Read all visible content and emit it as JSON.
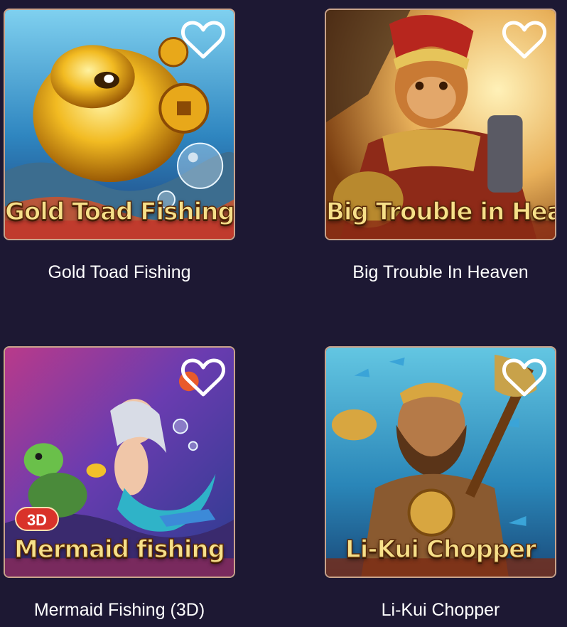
{
  "games": [
    {
      "title": "Gold Toad Fishing",
      "banner_text": "Gold Toad Fishing",
      "favorite_icon": "heart-outline-icon",
      "artwork": "golden-toad-underwater"
    },
    {
      "title": "Big Trouble In Heaven",
      "banner_text": "Big Trouble in Heaven",
      "favorite_icon": "heart-outline-icon",
      "artwork": "monkey-king-warrior"
    },
    {
      "title": "Mermaid Fishing (3D)",
      "banner_text": "Mermaid fishing",
      "badge": "3D",
      "favorite_icon": "heart-outline-icon",
      "artwork": "mermaid-and-turtle-underwater"
    },
    {
      "title": "Li-Kui Chopper",
      "banner_text": "Li-Kui Chopper",
      "favorite_icon": "heart-outline-icon",
      "artwork": "bearded-warrior-with-axe"
    }
  ],
  "colors": {
    "page_background": "#1d1833",
    "title_text": "#ffffff",
    "card_border": "#c9a38b",
    "banner_text": "#f6e08a",
    "badge_background": "#d9332a"
  }
}
